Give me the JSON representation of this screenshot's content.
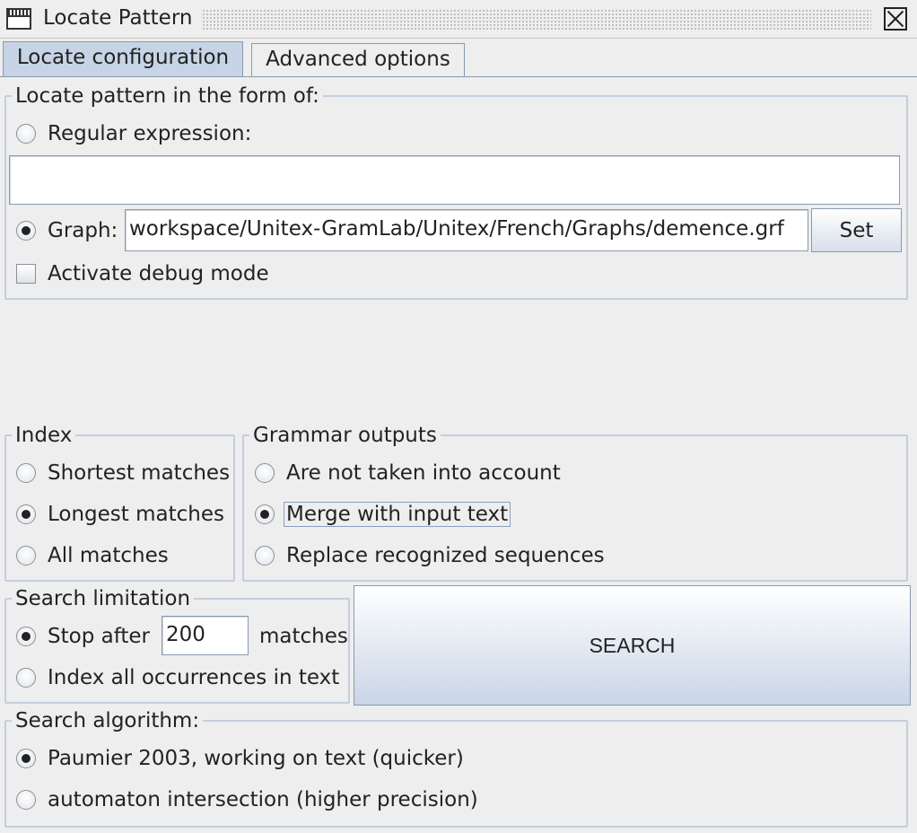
{
  "window": {
    "title": "Locate Pattern"
  },
  "tabs": [
    {
      "label": "Locate configuration",
      "active": true
    },
    {
      "label": "Advanced options",
      "active": false
    }
  ],
  "pattern": {
    "legend": "Locate pattern in the form of:",
    "regex_label": "Regular expression:",
    "regex_value": "",
    "graph_label": "Graph:",
    "graph_value": "workspace/Unitex-GramLab/Unitex/French/Graphs/demence.grf",
    "set_button": "Set",
    "debug_label": "Activate debug mode",
    "selected": "graph"
  },
  "index": {
    "legend": "Index",
    "options": [
      "Shortest matches",
      "Longest matches",
      "All matches"
    ],
    "selected": "Longest matches"
  },
  "grammar_outputs": {
    "legend": "Grammar outputs",
    "options": [
      "Are not taken into account",
      "Merge with input text",
      "Replace recognized sequences"
    ],
    "selected": "Merge with input text"
  },
  "search_limitation": {
    "legend": "Search limitation",
    "stop_after_label": "Stop after",
    "stop_after_value": "200",
    "matches_label": "matches",
    "index_all_label": "Index all occurrences in text",
    "selected": "stop_after"
  },
  "search_button": "SEARCH",
  "algorithm": {
    "legend": "Search algorithm:",
    "options": [
      "Paumier 2003, working on text (quicker)",
      "automaton intersection (higher precision)"
    ],
    "selected": "Paumier 2003, working on text (quicker)"
  }
}
